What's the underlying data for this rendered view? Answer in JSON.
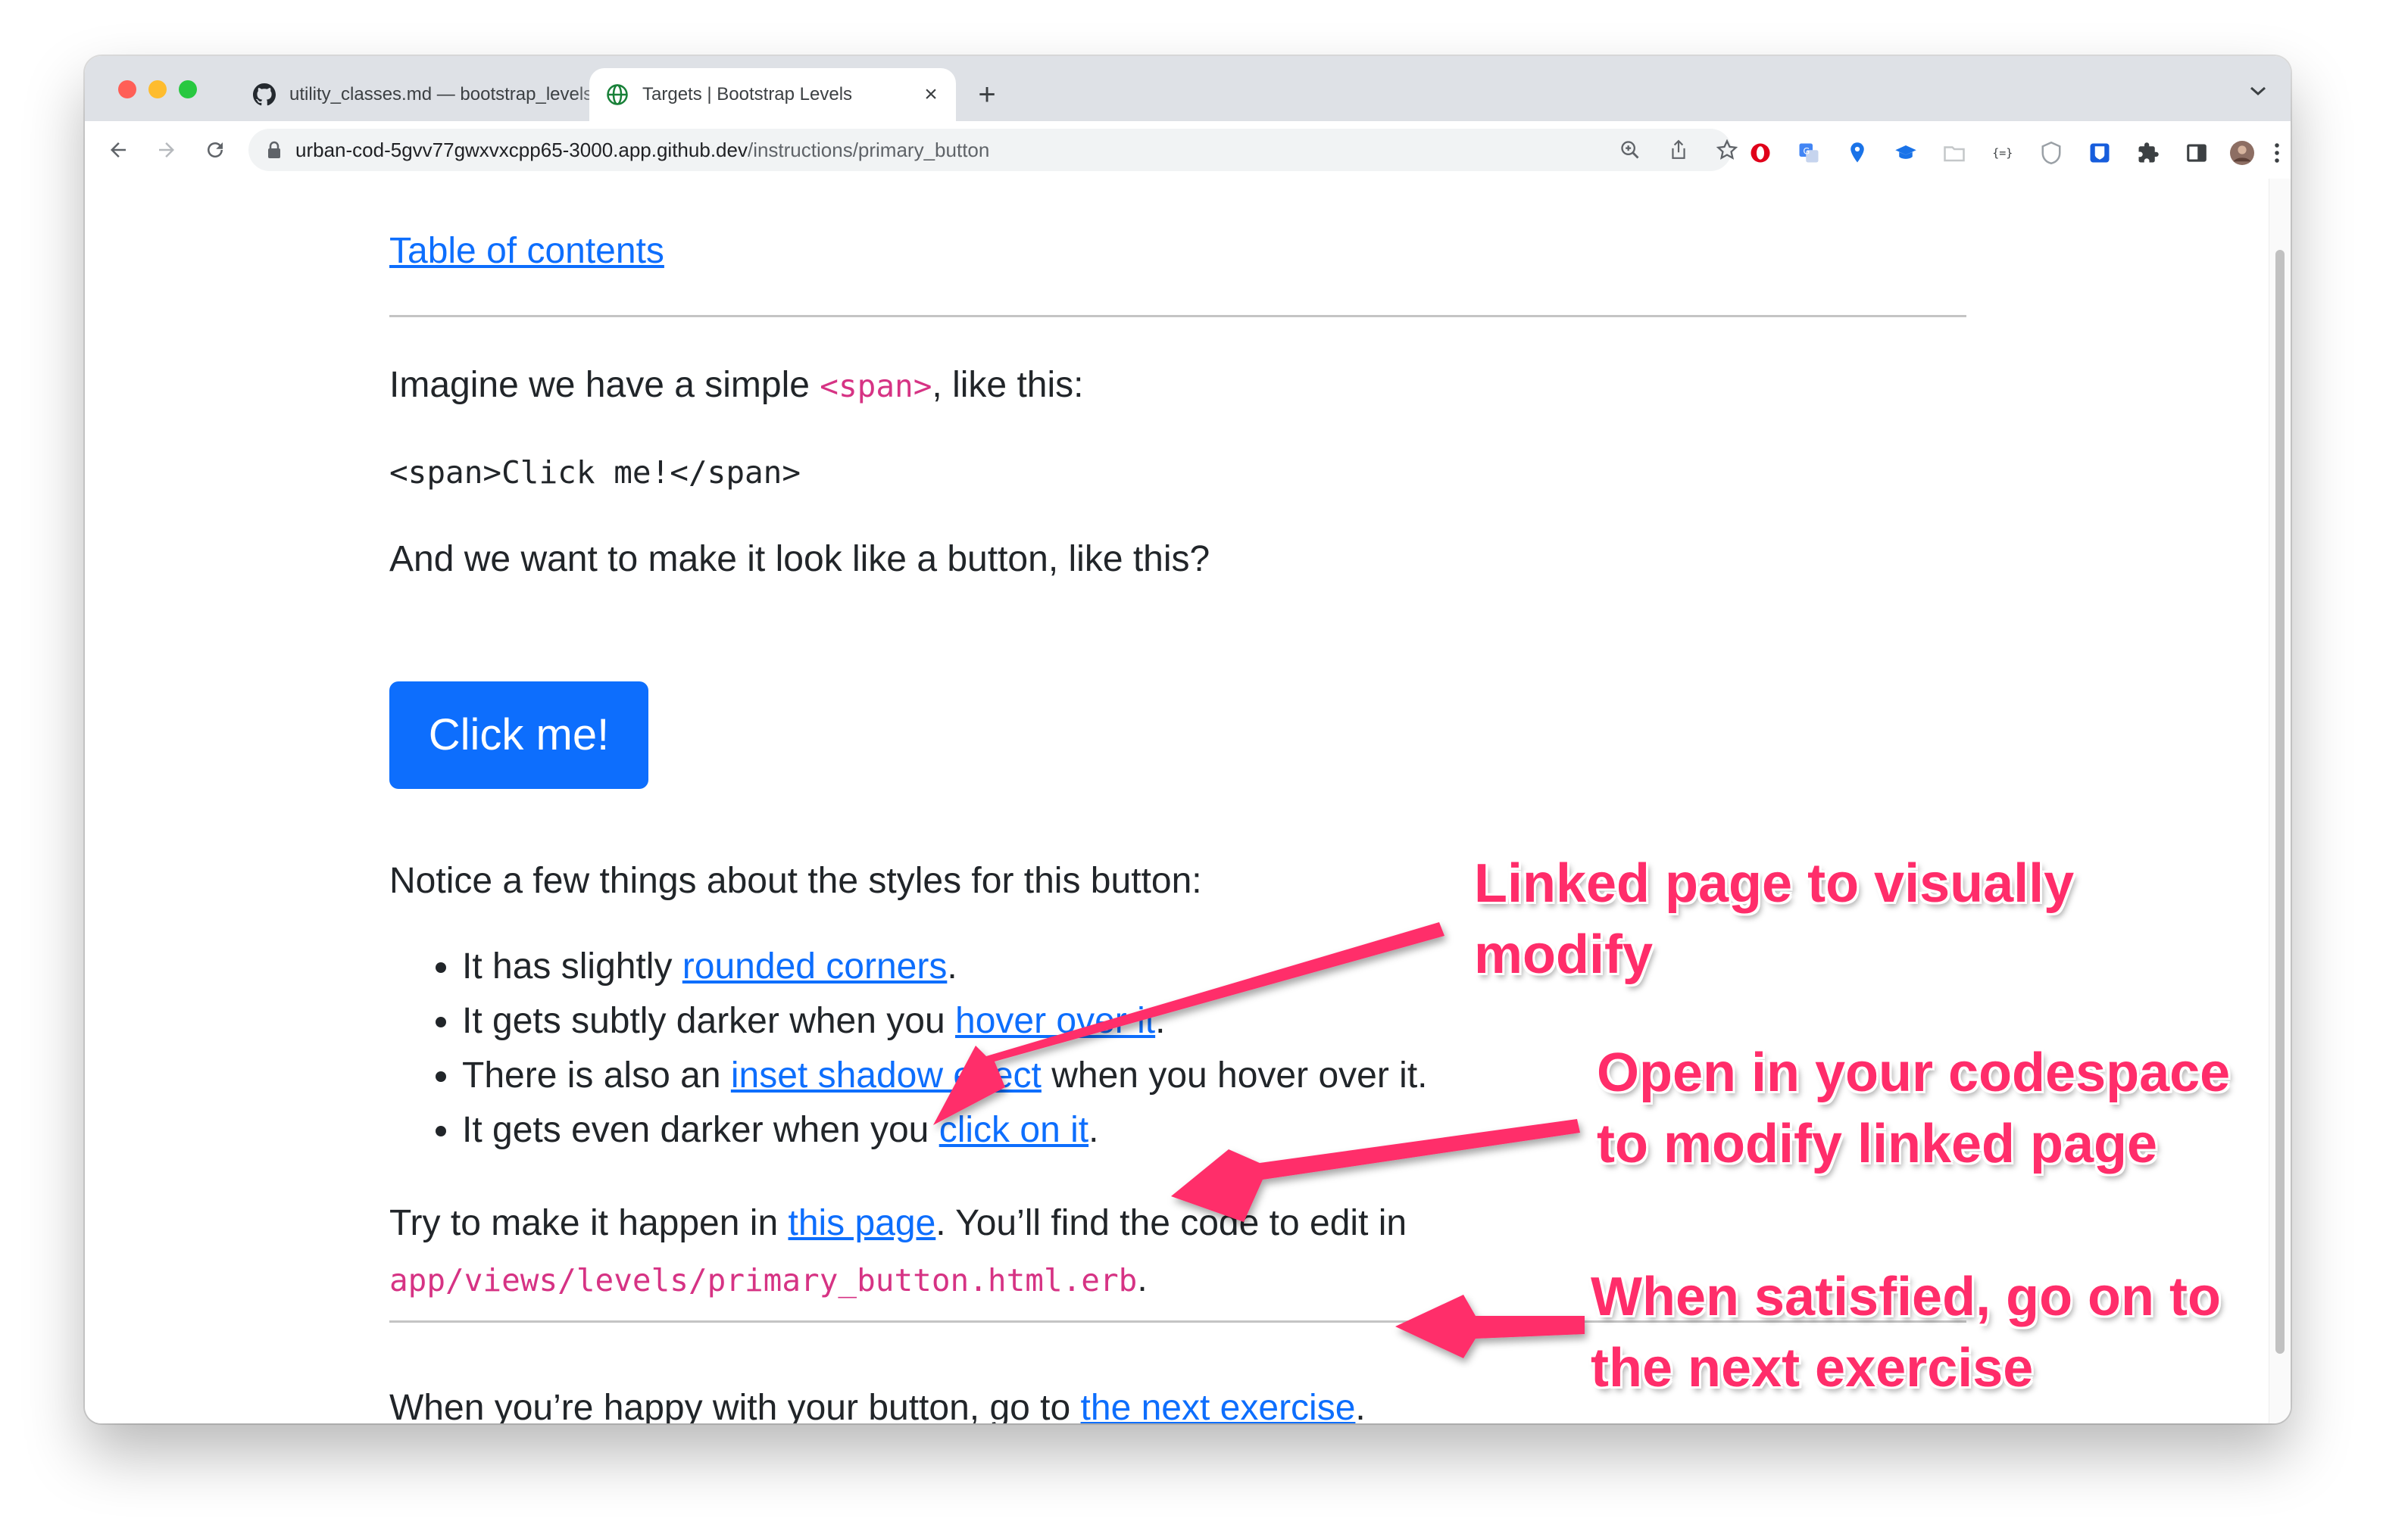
{
  "browser": {
    "tabs": [
      {
        "title": "utility_classes.md — bootstrap_levels",
        "favicon": "github-icon",
        "active": false
      },
      {
        "title": "Targets | Bootstrap Levels",
        "favicon": "globe-icon",
        "active": true
      }
    ],
    "new_tab_label": "+",
    "url": {
      "host": "urban-cod-5gvv77gwxvxcpp65-3000.app.github.dev",
      "path": "/instructions/primary_button"
    }
  },
  "page": {
    "toc_link": "Table of contents",
    "intro_before": "Imagine we have a simple ",
    "intro_code": "<span>",
    "intro_after": ", like this:",
    "code_example": "<span>Click me!</span>",
    "want_text": "And we want to make it look like a button, like this?",
    "button_label": "Click me!",
    "notice_text": "Notice a few things about the styles for this button:",
    "bullets": [
      {
        "before": "It has slightly ",
        "link": "rounded corners",
        "after": "."
      },
      {
        "before": "It gets subtly darker when you ",
        "link": "hover over it",
        "after": "."
      },
      {
        "before": "There is also an ",
        "link": "inset shadow effect",
        "after": " when you hover over it."
      },
      {
        "before": "It gets even darker when you ",
        "link": "click on it",
        "after": "."
      }
    ],
    "try_before": "Try to make it happen in ",
    "try_link": "this page",
    "try_after": ". You’ll find the code to edit in",
    "file_path": "app/views/levels/primary_button.html.erb",
    "file_after": ".",
    "happy_before": "When you’re happy with your button, go to ",
    "happy_link": "the next exercise",
    "happy_after": "."
  },
  "annotations": {
    "linked_page": [
      "Linked page to visually",
      "modify"
    ],
    "codespace": [
      "Open in your codespace",
      "to modify linked page"
    ],
    "next": [
      "When satisfied, go on to",
      "the next exercise"
    ]
  },
  "colors": {
    "annotation": "#ff2d6a",
    "link": "#0d6efd",
    "button": "#0d6efd",
    "code": "#d63384"
  }
}
